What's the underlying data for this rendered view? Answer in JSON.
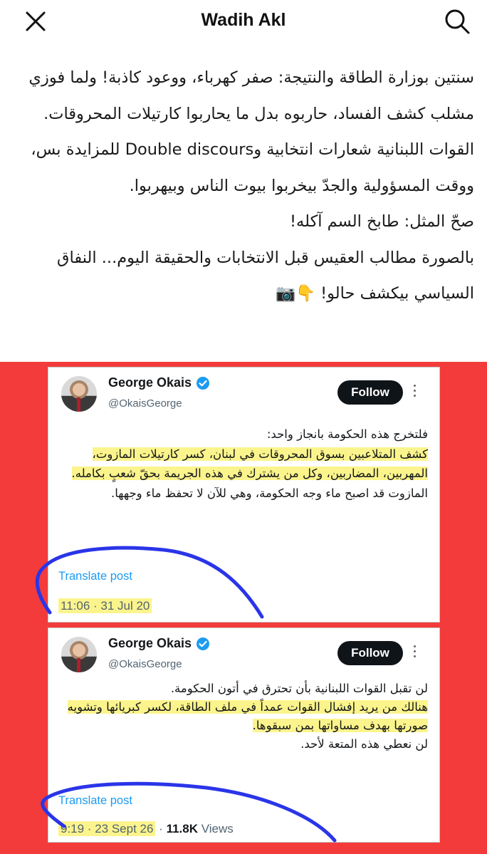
{
  "header": {
    "title": "Wadih Akl",
    "close_icon": "close-icon",
    "search_icon": "search-icon"
  },
  "post": {
    "paragraphs": [
      "سنتين بوزارة الطاقة والنتيجة: صفر كهرباء، ووعود كاذبة! ولما فوزي مشلب كشف الفساد، حاربوه بدل ما يحاربوا كارتيلات المحروقات.",
      "القوات اللبنانية شعارات انتخابية وDouble discours للمزايدة بس، ووقت المسؤولية والجدّ بيخربوا بيوت الناس وبيهربوا.",
      "صحّ المثل: طابخ السم آكله!",
      "بالصورة مطالب العقيس قبل الانتخابات والحقيقة اليوم... النفاق السياسي بيكشف حالو! 👇📷"
    ]
  },
  "tweets": [
    {
      "name": "George Okais",
      "handle": "@OkaisGeorge",
      "follow_label": "Follow",
      "lines": [
        {
          "text": "فلتخرج هذه الحكومة بانجاز واحد:",
          "hl": false
        },
        {
          "text": "كشف المتلاعبين بسوق المحروقات في لبنان، كسر كارتيلات المازوت، المهربين، المضاربين، وكل من يشترك في هذه الجريمة بحقّ شعبٍ بكامله.",
          "hl": true
        },
        {
          "text": "المازوت قد اصبح ماء وجه الحكومة، وهي للآن لا تحفظ ماء وجهها.",
          "hl": false
        }
      ],
      "translate": "Translate post",
      "time": "11:06 · 31 Jul 20"
    },
    {
      "name": "George Okais",
      "handle": "@OkaisGeorge",
      "follow_label": "Follow",
      "lines": [
        {
          "text": "لن تقبل القوات اللبنانية بأن تحترق في أتون الحكومة.",
          "hl": false
        },
        {
          "text": "هنالك من يريد إفشال القوات عمداً في ملف الطاقة، لكسر كبريائها وتشويه صورتها بهدف مساواتها بمن سبقوها.",
          "hl": true
        },
        {
          "text": "لن نعطي هذه المتعة لأحد.",
          "hl": false
        }
      ],
      "translate": "Translate post",
      "time": "9:19 · 23 Sept 26",
      "views_count": "11.8K",
      "views_label": "Views"
    }
  ],
  "colors": {
    "background_red": "#f33b3b",
    "highlight": "#fbf48c",
    "scribble": "#2a35e8",
    "link": "#1d9bf0"
  }
}
